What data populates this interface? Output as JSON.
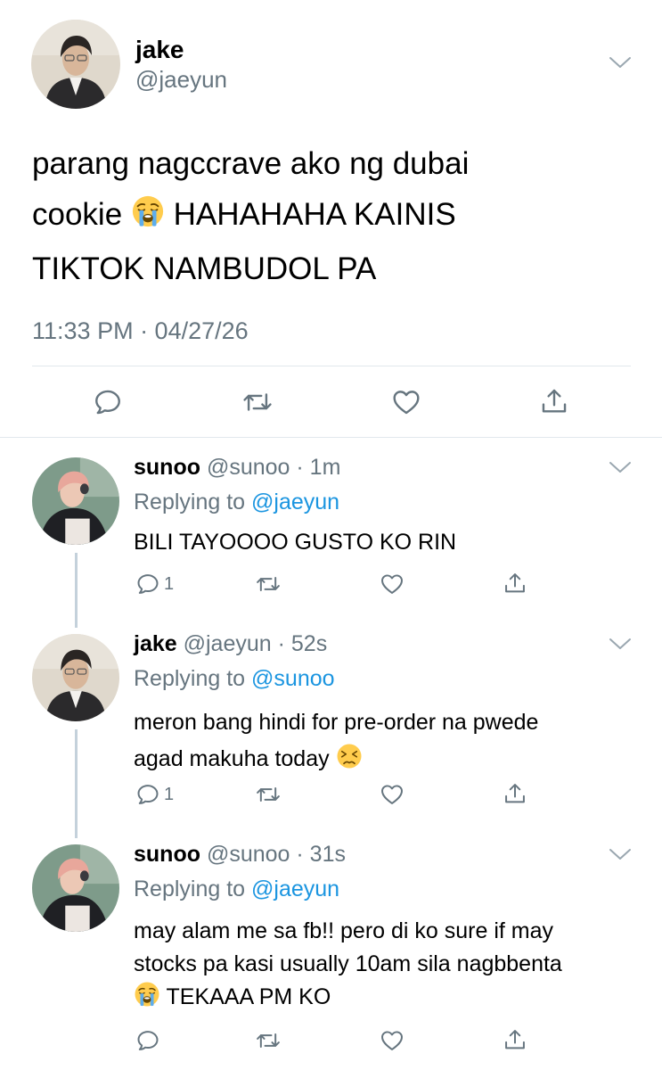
{
  "colors": {
    "text": "#000000",
    "secondary": "#66757f",
    "link": "#1b95e0",
    "divider": "#e1e8ed",
    "thread_line": "#c4d1db"
  },
  "main_tweet": {
    "display_name": "jake",
    "handle": "@jaeyun",
    "text_line1": "parang nagccrave ako ng dubai",
    "text_line2a": "cookie",
    "text_line2b": "HAHAHAHA KAINIS",
    "text_line3": "TIKTOK NAMBUDOL PA",
    "timestamp": "11:33 PM · 04/27/26"
  },
  "replies": [
    {
      "display_name": "sunoo",
      "handle_time": "@sunoo · 1m",
      "replying_prefix": "Replying to",
      "replying_to": "@jaeyun",
      "line1": "BILI TAYOOOO GUSTO KO RIN",
      "reply_count": "1"
    },
    {
      "display_name": "jake",
      "handle_time": "@jaeyun · 52s",
      "replying_prefix": "Replying to",
      "replying_to": "@sunoo",
      "line1": "meron bang hindi for pre-order na pwede",
      "line2": "agad makuha today",
      "reply_count": "1"
    },
    {
      "display_name": "sunoo",
      "handle_time": "@sunoo · 31s",
      "replying_prefix": "Replying to",
      "replying_to": "@jaeyun",
      "line1": "may alam me sa fb!! pero di ko sure if may",
      "line2": "stocks pa kasi usually 10am sila nagbbenta",
      "line3": "TEKAAA PM KO"
    }
  ],
  "icons": [
    "chevron-down-icon",
    "reply-icon",
    "retweet-icon",
    "like-icon",
    "share-icon",
    "loudly-crying-emoji",
    "persevering-face-emoji"
  ]
}
